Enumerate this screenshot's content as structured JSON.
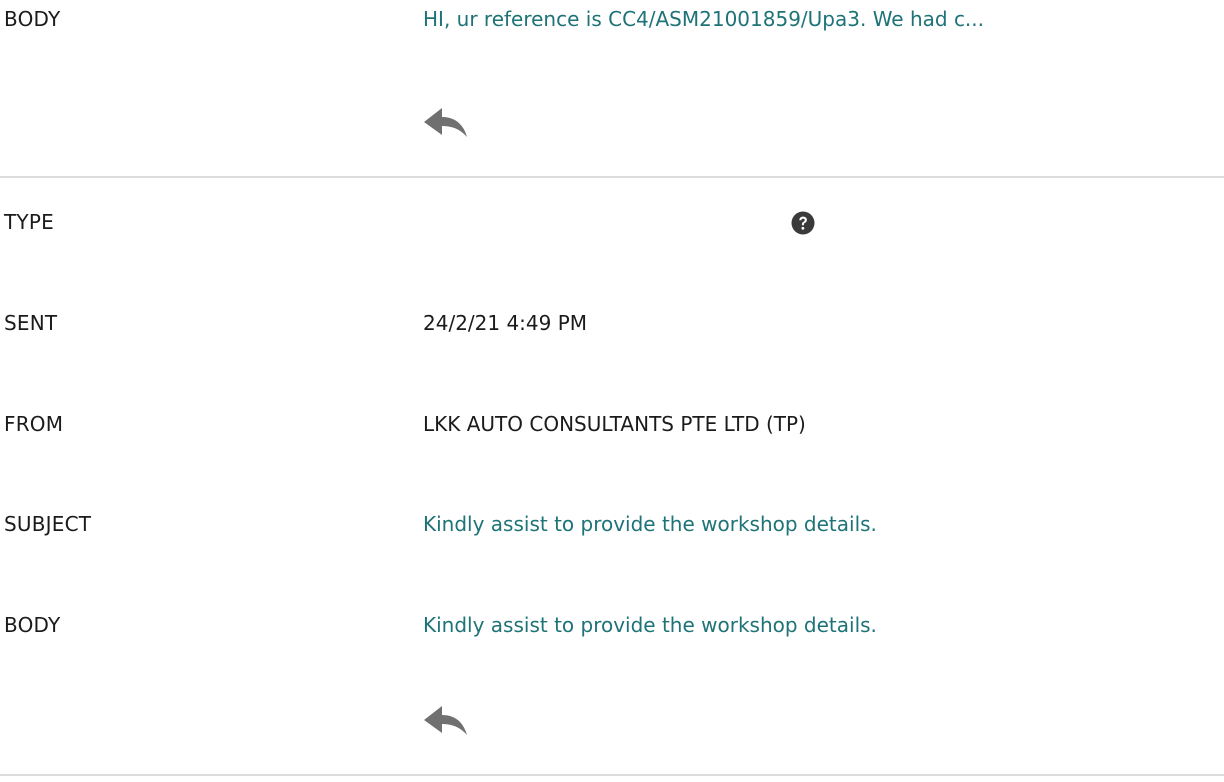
{
  "message1": {
    "body_label": "BODY",
    "body_value": "HI, ur reference is CC4/ASM21001859/Upa3. We had c..."
  },
  "message2": {
    "type_label": "TYPE",
    "sent_label": "SENT",
    "sent_value": "24/2/21 4:49 PM",
    "from_label": "FROM",
    "from_value": "LKK AUTO CONSULTANTS PTE LTD (TP)",
    "subject_label": "SUBJECT",
    "subject_value": "Kindly assist to provide the workshop details.",
    "body_label": "BODY",
    "body_value": "Kindly assist to provide the workshop details."
  },
  "icons": {
    "reply": "reply-icon",
    "help": "help-icon"
  },
  "colors": {
    "link": "#1e7377",
    "text": "#1b1b1b",
    "icon": "#707070",
    "divider": "#dcdcdc"
  }
}
